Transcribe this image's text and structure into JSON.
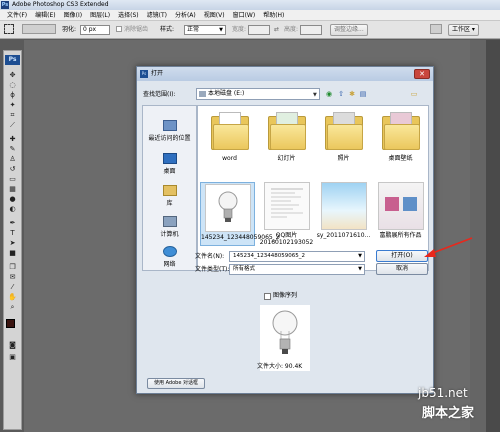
{
  "app": {
    "title": "Adobe Photoshop CS3 Extended",
    "logo_text": "Ps"
  },
  "menu": [
    "文件(F)",
    "编辑(E)",
    "图像(I)",
    "图层(L)",
    "选择(S)",
    "滤镜(T)",
    "分析(A)",
    "视图(V)",
    "窗口(W)",
    "帮助(H)"
  ],
  "options_bar": {
    "feather_label": "羽化:",
    "feather_value": "0 px",
    "antialias_label": "消除锯齿",
    "style_label": "样式:",
    "style_value": "正常",
    "width_label": "宽度:",
    "height_label": "高度:",
    "refine_edge_label": "调整边缘...",
    "workspace_label": "工作区 ▾"
  },
  "dialog": {
    "title": "打开",
    "look_in_label": "查找范围(I):",
    "look_in_value": "本地磁盘 (E:)",
    "places": [
      {
        "label": "最近访问的位置"
      },
      {
        "label": "桌面"
      },
      {
        "label": "库"
      },
      {
        "label": "计算机"
      },
      {
        "label": "网络"
      }
    ],
    "files": [
      {
        "name": "word",
        "kind": "folder"
      },
      {
        "name": "幻灯片",
        "kind": "folder"
      },
      {
        "name": "照片",
        "kind": "folder"
      },
      {
        "name": "桌面壁纸",
        "kind": "folder"
      },
      {
        "name": "145234_123448059065_2",
        "kind": "image",
        "selected": true
      },
      {
        "name": "QQ图片20160102193052",
        "kind": "image"
      },
      {
        "name": "sy_2011071610...",
        "kind": "image"
      },
      {
        "name": "富鹏展所有作品",
        "kind": "image"
      }
    ],
    "filename_label": "文件名(N):",
    "filename_value": "145234_123448059065_2",
    "filetype_label": "文件类型(T):",
    "filetype_value": "所有格式",
    "open_button": "打开(O)",
    "cancel_button": "取消",
    "image_sequence_label": "图像序列",
    "file_size_label": "文件大小: 90.4K",
    "adobe_dialog_button": "使用 Adobe 对话框"
  },
  "watermark": {
    "line1": "jb51.net",
    "line2": "脚本之家"
  }
}
